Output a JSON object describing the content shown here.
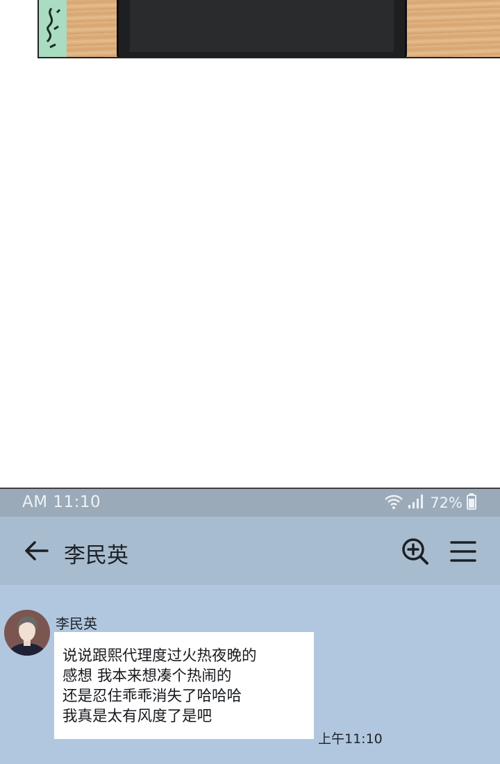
{
  "status_bar": {
    "time": "AM 11:10",
    "battery_percent": "72%",
    "icons": [
      "wifi-icon",
      "signal-icon",
      "battery-icon"
    ]
  },
  "app_bar": {
    "title": "李民英",
    "icons": [
      "back-arrow-icon",
      "zoom-in-icon",
      "menu-icon"
    ]
  },
  "message": {
    "sender": "李民英",
    "lines": [
      "说说跟熙代理度过火热夜晚的",
      "感想  我本来想凑个热闹的",
      "还是忍住乖乖消失了哈哈哈",
      "我真是太有风度了是吧"
    ],
    "time": "上午11:10"
  },
  "colors": {
    "status_bar": "#9aaab8",
    "app_bar": "#a8bccf",
    "chat_background": "#b1c7df",
    "bubble": "#ffffff"
  }
}
